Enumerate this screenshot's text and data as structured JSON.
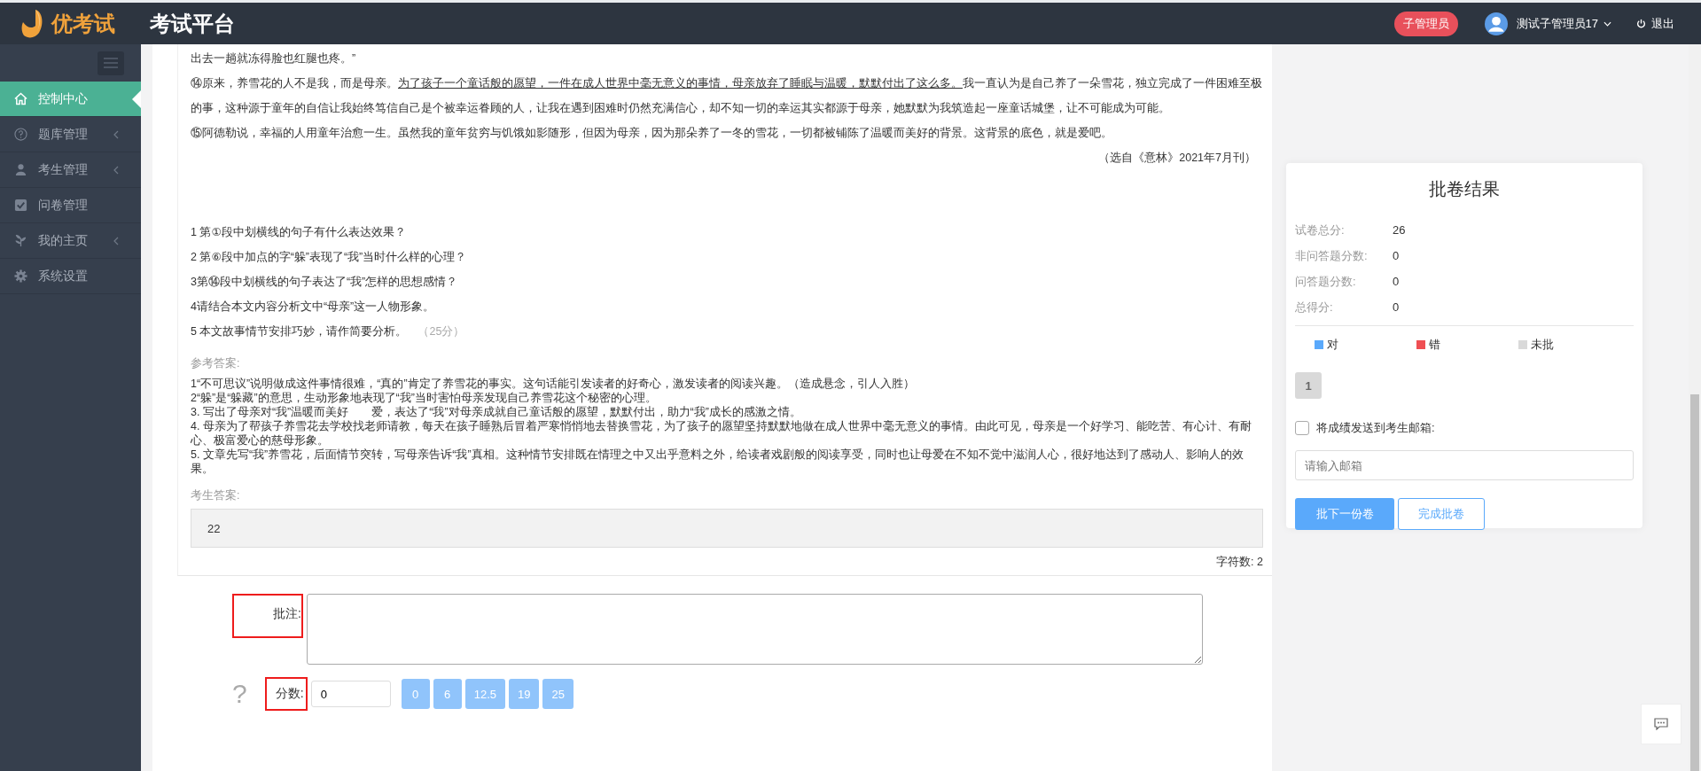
{
  "header": {
    "logo_text": "优考试",
    "title": "考试平台",
    "role_badge": "子管理员",
    "user_name": "测试子管理员17",
    "logout": "退出"
  },
  "sidebar": {
    "items": [
      {
        "label": "控制中心",
        "selected": true,
        "has_submenu": false
      },
      {
        "label": "题库管理",
        "selected": false,
        "has_submenu": true
      },
      {
        "label": "考生管理",
        "selected": false,
        "has_submenu": true
      },
      {
        "label": "问卷管理",
        "selected": false,
        "has_submenu": false
      },
      {
        "label": "我的主页",
        "selected": false,
        "has_submenu": true
      },
      {
        "label": "系统设置",
        "selected": false,
        "has_submenu": false
      }
    ]
  },
  "passage": {
    "paragraphs": [
      [
        {
          "text": "出去一趟就冻得脸也红腿也疼。”",
          "underline": false
        }
      ],
      [
        {
          "text": "⑭原来，养雪花的人不是我，而是母亲。",
          "underline": false
        },
        {
          "text": "为了孩子一个童话般的愿望，一件在成人世界中毫无意义的事情，母亲放弃了睡眠与温暖，默默付出了这么多。",
          "underline": true
        },
        {
          "text": "我一直认为是自己养了一朵雪花，独立完成了一件困难至极的事，这种源于童年的自信让我始终笃信自己是个被幸运眷顾的人，让我在遇到困难时仍然充满信心，却不知一切的幸运其实都源于母亲，她默默为我筑造起一座童话城堡，让不可能成为可能。",
          "underline": false
        }
      ],
      [
        {
          "text": "⑮阿德勒说，幸福的人用童年治愈一生。虽然我的童年贫穷与饥饿如影随形，但因为母亲，因为那朵养了一冬的雪花，一切都被铺陈了温暖而美好的背景。这背景的底色，就是爱吧。",
          "underline": false
        }
      ]
    ],
    "source": "（选自《意林》2021年7月刊）"
  },
  "questions": [
    "1 第①段中划横线的句子有什么表达效果？",
    "2 第⑥段中加点的字“躲”表现了“我”当时什么样的心理？",
    "3第⑭段中划横线的句子表达了“我”怎样的思想感情？",
    "4请结合本文内容分析文中“母亲”这一人物形象。",
    "5 本文故事情节安排巧妙，请作简要分析。"
  ],
  "question_score": "（25分）",
  "reference_label": "参考答案:",
  "reference_answers": [
    "1“不可思议”说明做成这件事情很难，“真的”肯定了养雪花的事实。这句话能引发读者的好奇心，激发读者的阅读兴趣。（造成悬念，引人入胜）",
    "2“躲”是“躲藏”的意思，生动形象地表现了“我”当时害怕母亲发现自己养雪花这个秘密的心理。",
    "3. 写出了母亲对“我”温暖而美好　　爱，表达了“我”对母亲成就自己童话般的愿望，默默付出，助力“我”成长的感激之情。",
    "4. 母亲为了帮孩子养雪花去学校找老师请教，每天在孩子睡熟后冒着严寒悄悄地去替换雪花，为了孩子的愿望坚持默默地做在成人世界中毫无意义的事情。由此可见，母亲是一个好学习、能吃苦、有心计、有耐心、极富爱心的慈母形象。",
    "5. 文章先写“我”养雪花，后面情节突转，写母亲告诉“我”真相。这种情节安排既在情理之中又出乎意料之外，给读者戏剧般的阅读享受，同时也让母爱在不知不觉中滋润人心，很好地达到了感动人、影响人的效果。"
  ],
  "student_answer_label": "考生答案:",
  "student_answer": "22",
  "char_count": "字符数: 2",
  "grading": {
    "comment_label": "批注:",
    "comment_highlighted": true,
    "help": "?",
    "score_label": "分数:",
    "score_highlighted": true,
    "score_value": "0",
    "quick_scores": [
      "0",
      "6",
      "12.5",
      "19",
      "25"
    ]
  },
  "result_panel": {
    "title": "批卷结果",
    "stats": [
      {
        "label": "试卷总分:",
        "value": "26"
      },
      {
        "label": "非问答题分数:",
        "value": "0"
      },
      {
        "label": "问答题分数:",
        "value": "0"
      },
      {
        "label": "总得分:",
        "value": "0"
      }
    ],
    "legend": [
      {
        "label": "对",
        "color": "#5aa9fb"
      },
      {
        "label": "错",
        "color": "#ef4f53"
      },
      {
        "label": "未批",
        "color": "#d9d9d9"
      }
    ],
    "question_numbers": [
      {
        "label": "1",
        "color": "#d9d9d9"
      }
    ],
    "send_email": {
      "label": "将成绩发送到考生邮箱:",
      "checked": false
    },
    "email_placeholder": "请输入邮箱",
    "buttons": [
      {
        "label": "批下一份卷",
        "kind": "primary"
      },
      {
        "label": "完成批卷",
        "kind": "outline"
      }
    ]
  }
}
